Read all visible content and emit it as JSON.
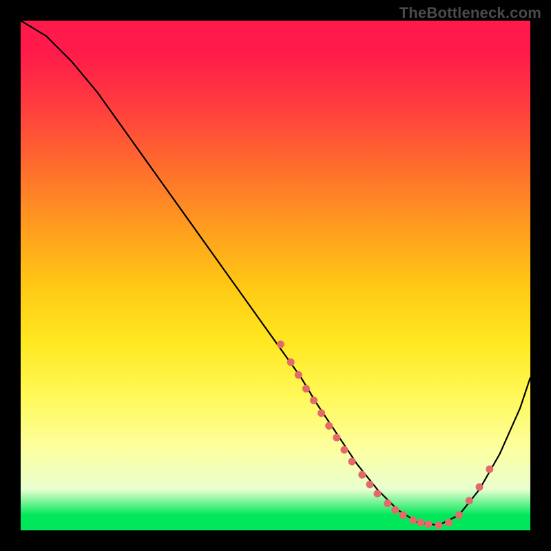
{
  "watermark": "TheBottleneck.com",
  "colors": {
    "background": "#000000",
    "curve": "#000000",
    "dot": "#e46a6a",
    "watermark": "#4a4a4a"
  },
  "chart_data": {
    "type": "line",
    "title": "",
    "xlabel": "",
    "ylabel": "",
    "xlim": [
      0,
      100
    ],
    "ylim": [
      0,
      100
    ],
    "series": [
      {
        "name": "bottleneck-curve",
        "x": [
          0,
          5,
          10,
          15,
          20,
          25,
          30,
          35,
          40,
          45,
          50,
          55,
          58,
          62,
          66,
          70,
          74,
          78,
          82,
          86,
          90,
          94,
          98,
          100
        ],
        "y": [
          100,
          97,
          92,
          86,
          79,
          72,
          65,
          58,
          51,
          44,
          37,
          30,
          25,
          19,
          13,
          8,
          4,
          1.5,
          1,
          3,
          8,
          15,
          24,
          30
        ]
      }
    ],
    "scatter_points": [
      {
        "x": 51,
        "y": 36.5,
        "label": "dot"
      },
      {
        "x": 53,
        "y": 33.0,
        "label": "dot"
      },
      {
        "x": 54.5,
        "y": 30.5,
        "label": "dot"
      },
      {
        "x": 56,
        "y": 27.8,
        "label": "dot"
      },
      {
        "x": 57.5,
        "y": 25.5,
        "label": "dot"
      },
      {
        "x": 59,
        "y": 23.0,
        "label": "dot"
      },
      {
        "x": 60.5,
        "y": 20.5,
        "label": "dot"
      },
      {
        "x": 62,
        "y": 18.2,
        "label": "dot"
      },
      {
        "x": 63.5,
        "y": 15.8,
        "label": "dot"
      },
      {
        "x": 65,
        "y": 13.5,
        "label": "dot"
      },
      {
        "x": 67,
        "y": 10.9,
        "label": "dot"
      },
      {
        "x": 68.5,
        "y": 9.0,
        "label": "dot"
      },
      {
        "x": 70,
        "y": 7.2,
        "label": "dot"
      },
      {
        "x": 72,
        "y": 5.3,
        "label": "dot"
      },
      {
        "x": 73.5,
        "y": 4.0,
        "label": "dot"
      },
      {
        "x": 75,
        "y": 3.0,
        "label": "dot"
      },
      {
        "x": 77,
        "y": 2.0,
        "label": "dot"
      },
      {
        "x": 78.5,
        "y": 1.5,
        "label": "dot"
      },
      {
        "x": 80,
        "y": 1.2,
        "label": "dot"
      },
      {
        "x": 82,
        "y": 1.0,
        "label": "dot"
      },
      {
        "x": 84,
        "y": 1.5,
        "label": "dot"
      },
      {
        "x": 86,
        "y": 3.0,
        "label": "dot"
      },
      {
        "x": 88,
        "y": 5.8,
        "label": "dot"
      },
      {
        "x": 90,
        "y": 8.5,
        "label": "dot"
      },
      {
        "x": 92,
        "y": 12.0,
        "label": "dot"
      }
    ]
  }
}
